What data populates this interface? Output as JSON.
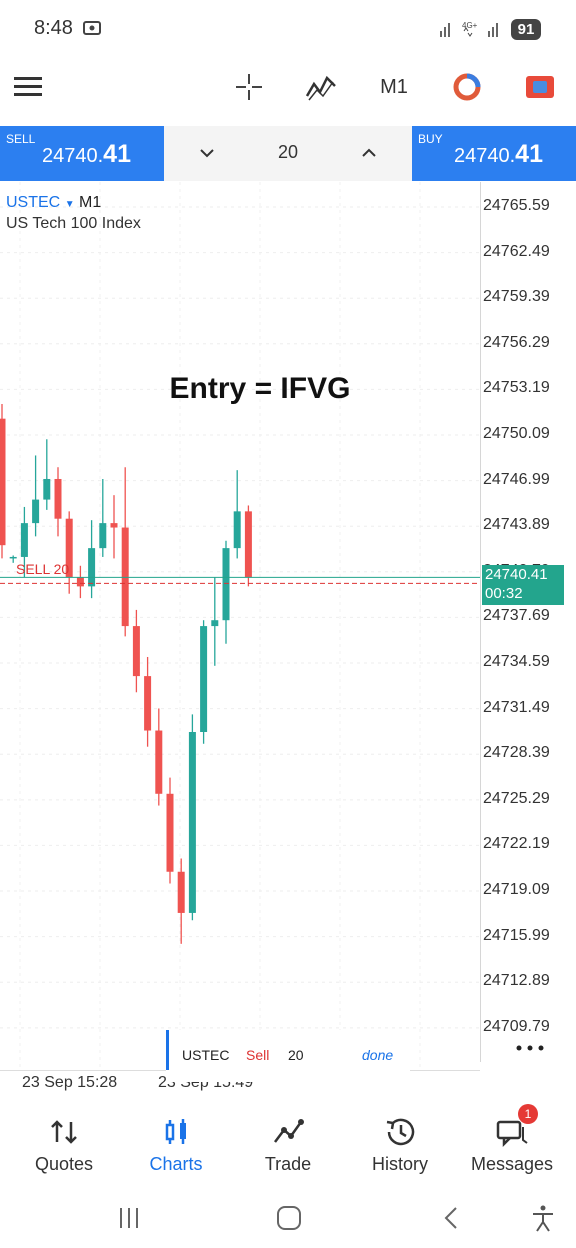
{
  "status_bar": {
    "time": "8:48",
    "network": "4G+",
    "battery": "91"
  },
  "toolbar": {
    "timeframe": "M1"
  },
  "trade_bar": {
    "sell_label": "SELL",
    "sell_price_main": "24740.",
    "sell_price_big": "41",
    "buy_label": "BUY",
    "buy_price_main": "24740.",
    "buy_price_big": "41",
    "volume": "20"
  },
  "chart": {
    "symbol": "USTEC",
    "timeframe": "M1",
    "description": "US Tech 100 Index",
    "annotation": "Entry = IFVG",
    "sell_line_label": "SELL 20",
    "current_price": "24740.41",
    "countdown": "00:32",
    "price_ticks": [
      "24765.59",
      "24762.49",
      "24759.39",
      "24756.29",
      "24753.19",
      "24750.09",
      "24746.99",
      "24743.89",
      "24740.79",
      "24737.69",
      "24734.59",
      "24731.49",
      "24728.39",
      "24725.29",
      "24722.19",
      "24719.09",
      "24715.99",
      "24712.89",
      "24709.79"
    ],
    "time_labels": [
      "23 Sep 15:28",
      "23 Sep 15:49"
    ],
    "colors": {
      "bull": "#26a69a",
      "bear": "#ef5350",
      "accent": "#2c7ff0"
    }
  },
  "chart_data": {
    "type": "candlestick",
    "symbol": "USTEC",
    "timeframe": "M1",
    "ylim": [
      24708.24,
      24767.14
    ],
    "current_price": 24740.41,
    "sell_line": 24740.0,
    "candles": [
      {
        "o": 24751.2,
        "h": 24752.2,
        "l": 24741.7,
        "c": 24742.6
      },
      {
        "o": 24741.7,
        "h": 24741.9,
        "l": 24741.4,
        "c": 24741.8
      },
      {
        "o": 24741.8,
        "h": 24745.2,
        "l": 24740.4,
        "c": 24744.1
      },
      {
        "o": 24744.1,
        "h": 24748.7,
        "l": 24743.2,
        "c": 24745.7
      },
      {
        "o": 24745.7,
        "h": 24749.8,
        "l": 24745.0,
        "c": 24747.1
      },
      {
        "o": 24747.1,
        "h": 24747.9,
        "l": 24743.2,
        "c": 24744.4
      },
      {
        "o": 24744.4,
        "h": 24744.9,
        "l": 24739.3,
        "c": 24740.4
      },
      {
        "o": 24740.4,
        "h": 24741.2,
        "l": 24739.0,
        "c": 24739.8
      },
      {
        "o": 24739.8,
        "h": 24744.3,
        "l": 24739.0,
        "c": 24742.4
      },
      {
        "o": 24742.4,
        "h": 24747.1,
        "l": 24741.8,
        "c": 24744.1
      },
      {
        "o": 24744.1,
        "h": 24746.0,
        "l": 24741.7,
        "c": 24743.8
      },
      {
        "o": 24743.8,
        "h": 24747.9,
        "l": 24736.4,
        "c": 24737.1
      },
      {
        "o": 24737.1,
        "h": 24738.2,
        "l": 24732.6,
        "c": 24733.7
      },
      {
        "o": 24733.7,
        "h": 24735.0,
        "l": 24728.9,
        "c": 24730.0
      },
      {
        "o": 24730.0,
        "h": 24731.5,
        "l": 24724.9,
        "c": 24725.7
      },
      {
        "o": 24725.7,
        "h": 24726.8,
        "l": 24719.6,
        "c": 24720.4
      },
      {
        "o": 24720.4,
        "h": 24721.3,
        "l": 24715.5,
        "c": 24717.6
      },
      {
        "o": 24717.6,
        "h": 24731.1,
        "l": 24717.1,
        "c": 24729.9
      },
      {
        "o": 24729.9,
        "h": 24737.5,
        "l": 24729.1,
        "c": 24737.1
      },
      {
        "o": 24737.1,
        "h": 24740.4,
        "l": 24734.4,
        "c": 24737.5
      },
      {
        "o": 24737.5,
        "h": 24742.9,
        "l": 24735.9,
        "c": 24742.4
      },
      {
        "o": 24742.4,
        "h": 24747.7,
        "l": 24741.7,
        "c": 24744.9
      },
      {
        "o": 24744.9,
        "h": 24745.3,
        "l": 24739.8,
        "c": 24740.4
      }
    ]
  },
  "order_overlay": {
    "symbol": "USTEC",
    "side": "Sell",
    "volume": "20",
    "action": "done"
  },
  "nav": [
    {
      "label": "Quotes"
    },
    {
      "label": "Charts"
    },
    {
      "label": "Trade"
    },
    {
      "label": "History"
    },
    {
      "label": "Messages",
      "badge": "1"
    }
  ]
}
